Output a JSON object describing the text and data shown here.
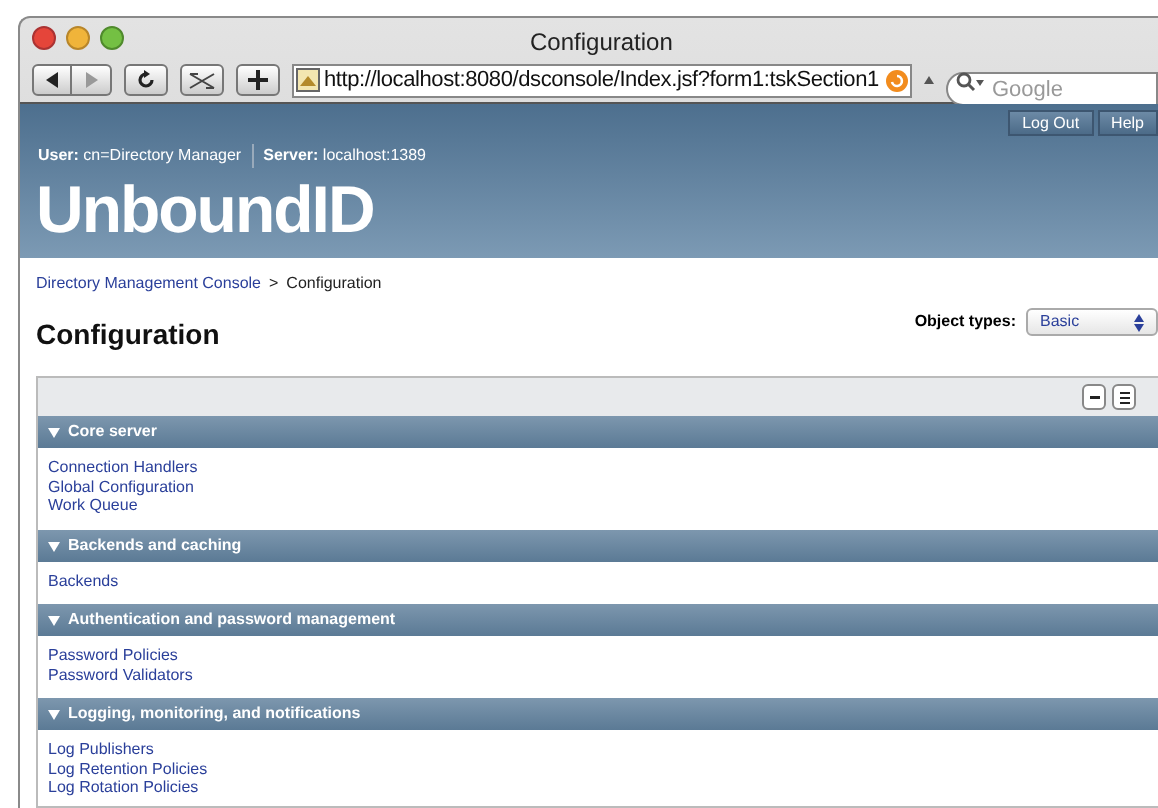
{
  "window": {
    "title": "Configuration"
  },
  "toolbar": {
    "url": "http://localhost:8080/dsconsole/Index.jsf?form1:tskSection1",
    "search_placeholder": "Google"
  },
  "header": {
    "buttons": [
      "Log Out",
      "Help"
    ],
    "user_label": "User:",
    "user": "cn=Directory Manager",
    "server_label": "Server:",
    "server": "localhost:1389",
    "logo": "UnboundID"
  },
  "breadcrumb": [
    {
      "label": "Directory Management Console",
      "link": true
    },
    {
      "label": ">",
      "link": false
    },
    {
      "label": "Configuration",
      "link": false
    }
  ],
  "page_title": "Configuration",
  "object_types": {
    "label": "Object types:",
    "value": "Basic"
  },
  "sections": [
    {
      "title": "Core server",
      "expanded": true,
      "items": [
        "Connection Handlers",
        "Global Configuration",
        "Work Queue"
      ]
    },
    {
      "title": "Backends and caching",
      "expanded": true,
      "items": [
        "Backends"
      ]
    },
    {
      "title": "Authentication and password management",
      "expanded": true,
      "items": [
        "Password Policies",
        "Password Validators"
      ]
    },
    {
      "title": "Logging, monitoring, and notifications",
      "expanded": true,
      "items": [
        "Log Publishers",
        "Log Retention Policies",
        "Log Rotation Policies"
      ]
    }
  ]
}
